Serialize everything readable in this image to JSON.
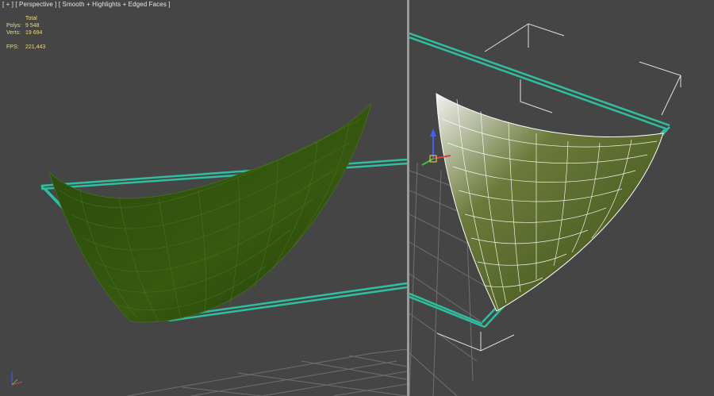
{
  "viewport_left": {
    "label_plus": "[ + ]",
    "label_view": "[ Perspective ]",
    "label_shading": "[ Smooth + Highlights + Edged Faces ]",
    "stats": {
      "header": "Total",
      "polys_label": "Polys:",
      "polys_value": "9 548",
      "verts_label": "Verts:",
      "verts_value": "19 694",
      "fps_label": "FPS:",
      "fps_value": "221,443"
    }
  },
  "colors": {
    "background": "#454545",
    "mesh_fill": "#2f4d10",
    "mesh_wire": "#3f6b1a",
    "mesh_fill_selected": "#4a5a1c",
    "wire_selected": "#ffffff",
    "frame": "#2fbfa0",
    "grid": "#7a7a7a",
    "gizmo_x": "#e04040",
    "gizmo_y": "#40c040",
    "gizmo_z": "#4060ff"
  }
}
